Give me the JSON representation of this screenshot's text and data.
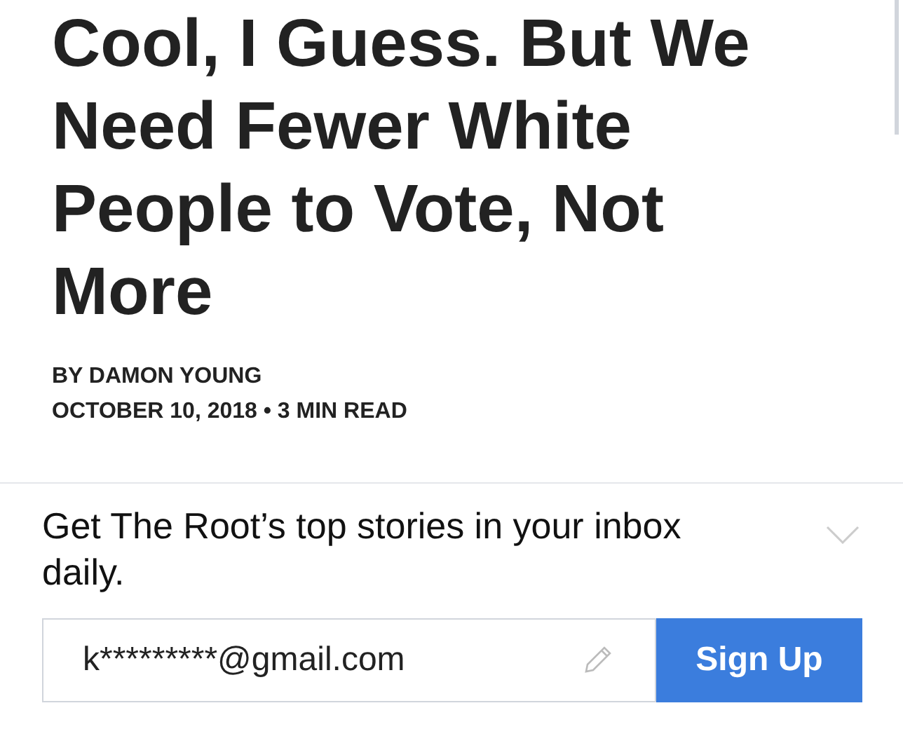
{
  "article": {
    "headline": "Cool, I Guess. But We Need Fewer White People to Vote, Not More",
    "byline": "BY DAMON YOUNG",
    "meta": "OCTOBER 10, 2018 • 3 MIN READ"
  },
  "newsletter": {
    "prompt": "Get The Root’s top stories in your inbox daily.",
    "email": {
      "value": "k*********@gmail.com"
    },
    "button": "Sign Up"
  }
}
